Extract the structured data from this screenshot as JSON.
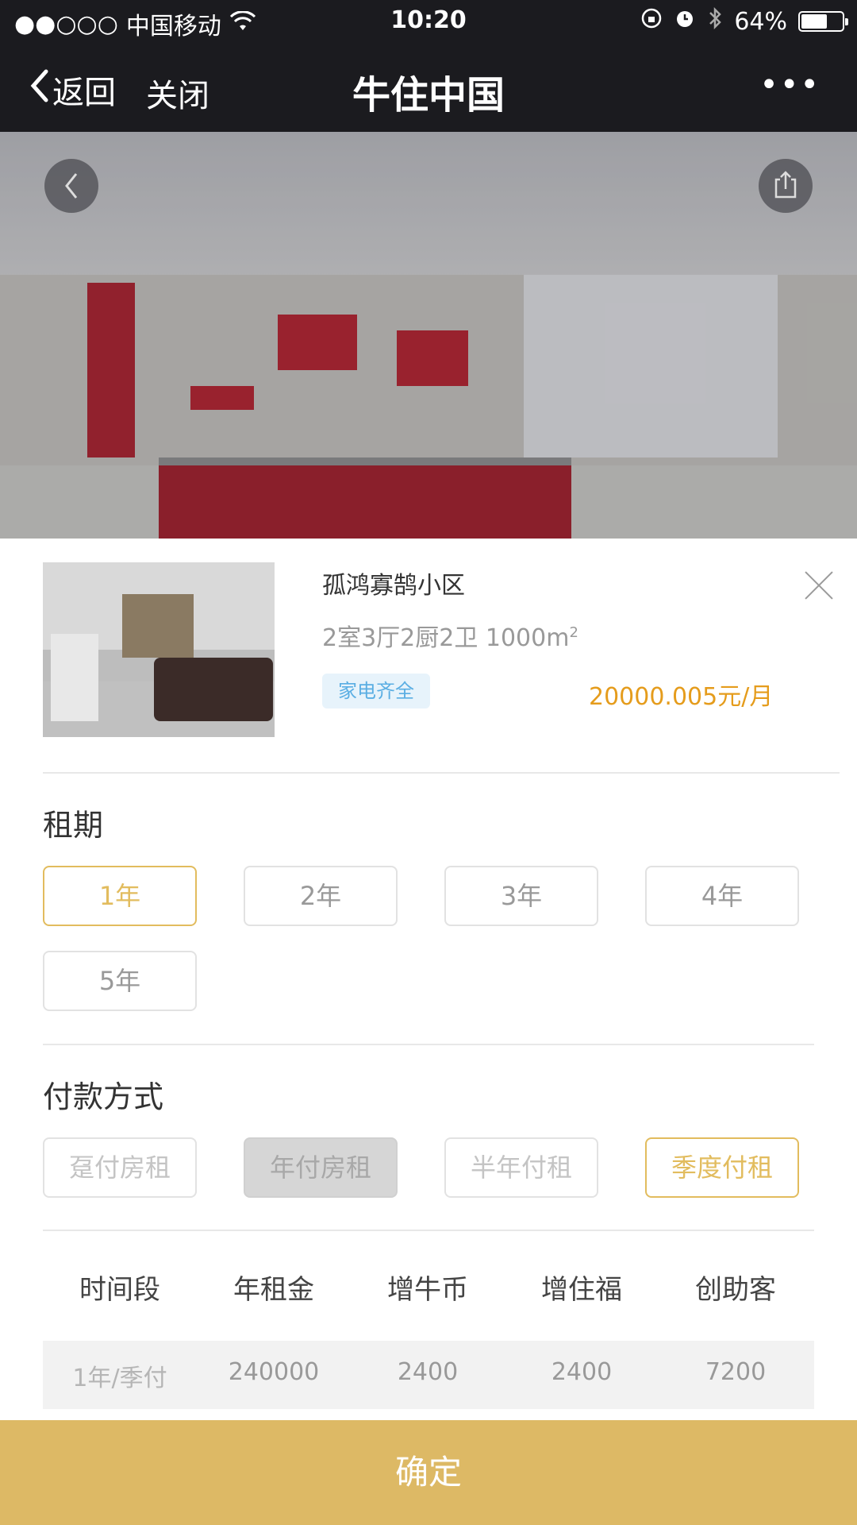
{
  "status_bar": {
    "signal": "●●○○○",
    "carrier": "中国移动",
    "time": "10:20",
    "battery": "64%",
    "battery_level": 0.64
  },
  "nav": {
    "back_label": "返回",
    "close_label": "关闭",
    "title": "牛住中国",
    "more_label": "•••"
  },
  "listing": {
    "name": "孤鸿寡鹄小区",
    "spec": "2室3厅2厨2卫 1000m",
    "spec_unit_sup": "2",
    "tag": "家电齐全",
    "price": "20000.005元/月"
  },
  "lease_term": {
    "title": "租期",
    "options": [
      "1年",
      "2年",
      "3年",
      "4年",
      "5年"
    ],
    "selected": "1年"
  },
  "payment": {
    "title": "付款方式",
    "options": [
      "趸付房租",
      "年付房租",
      "半年付租",
      "季度付租"
    ],
    "selected": "季度付租"
  },
  "table": {
    "headers": [
      "时间段",
      "年租金",
      "增牛币",
      "增住福",
      "创助客"
    ],
    "row": [
      "1年/季付",
      "240000",
      "2400",
      "2400",
      "7200"
    ]
  },
  "confirm_label": "确定"
}
